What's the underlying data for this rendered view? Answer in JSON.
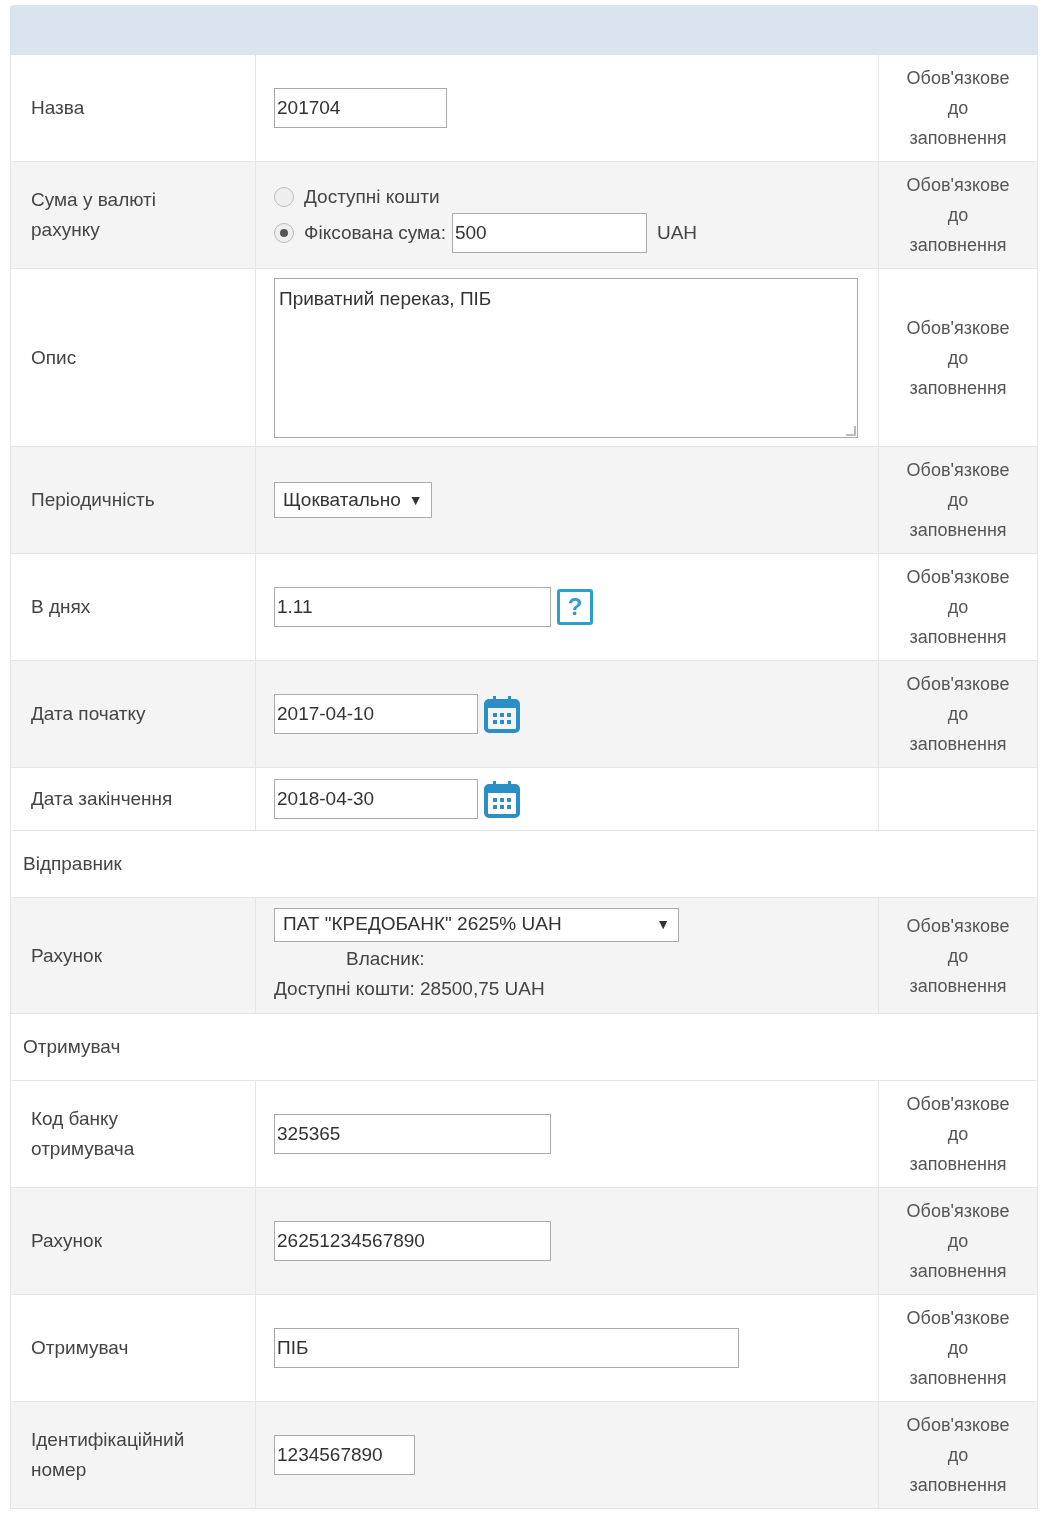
{
  "rows": [
    {
      "kind": "field",
      "label": "Назва",
      "control": {
        "kind": "text",
        "value": "201704"
      },
      "note": "Обов'язкове до заповнення"
    },
    {
      "kind": "field",
      "label": "Сума у валюті рахунку",
      "control": {
        "kind": "radio",
        "options": [
          {
            "label": "Доступні кошти",
            "selected": false
          },
          {
            "label": "Фіксована сума:",
            "selected": true,
            "value": "500",
            "unit": "UAH"
          }
        ]
      },
      "note": "Обов'язкове до заповнення"
    },
    {
      "kind": "field",
      "label": "Опис",
      "control": {
        "kind": "textarea",
        "value": "Приватний переказ, ПІБ"
      },
      "note": "Обов'язкове до заповнення"
    },
    {
      "kind": "field",
      "label": "Періодичність",
      "control": {
        "kind": "select",
        "value": "Щокватально",
        "arrow": "▼"
      },
      "note": "Обов'язкове до заповнення"
    },
    {
      "kind": "field",
      "label": "В днях",
      "control": {
        "kind": "help_text",
        "value": "1.11",
        "help": "?"
      },
      "note": "Обов'язкове до заповнення"
    },
    {
      "kind": "field",
      "label": "Дата початку",
      "control": {
        "kind": "date",
        "value": "2017-04-10"
      },
      "note": "Обов'язкове до заповнення"
    },
    {
      "kind": "field",
      "label": "Дата закінчення",
      "control": {
        "kind": "date",
        "value": "2018-04-30"
      }
    },
    {
      "kind": "section",
      "label": "Відправник"
    },
    {
      "kind": "field",
      "label": "Рахунок",
      "control": {
        "kind": "account",
        "value": "ПАТ \"КРЕДОБАНК\" 2625% UAH",
        "arrow": "▼",
        "owner": "Власник:",
        "available": "Доступні кошти: 28500,75 UAH"
      },
      "note": "Обов'язкове до заповнення"
    },
    {
      "kind": "section",
      "label": "Отримувач"
    },
    {
      "kind": "field",
      "label": "Код банку отримувача",
      "control": {
        "kind": "text",
        "value": "325365"
      },
      "note": "Обов'язкове до заповнення"
    },
    {
      "kind": "field",
      "label": "Рахунок",
      "control": {
        "kind": "text",
        "value": "26251234567890"
      },
      "note": "Обов'язкове до заповнення"
    },
    {
      "kind": "field",
      "label": "Отримувач",
      "control": {
        "kind": "text",
        "value": "ПІБ"
      },
      "note": "Обов'язкове до заповнення"
    },
    {
      "kind": "field",
      "label": "Ідентифікаційний номер",
      "control": {
        "kind": "text",
        "value": "1234567890"
      },
      "note": "Обов'язкове до заповнення"
    }
  ]
}
